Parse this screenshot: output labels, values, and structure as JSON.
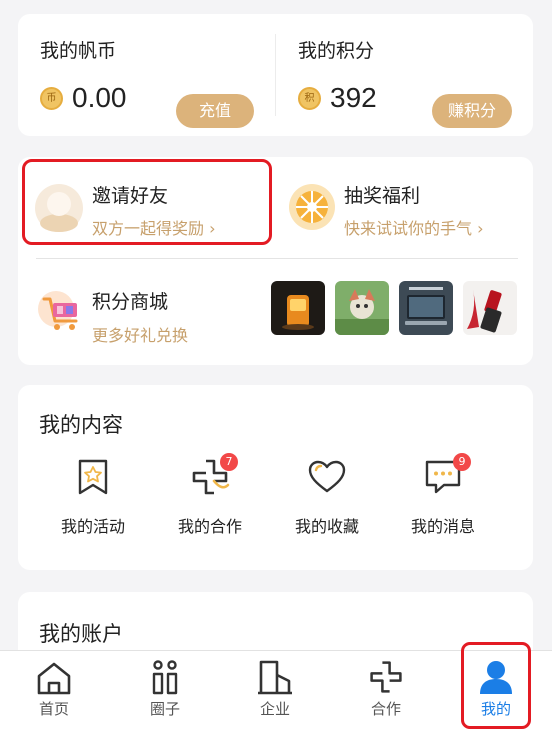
{
  "wallet": {
    "coins": {
      "title": "我的帆币",
      "coin_glyph": "币",
      "value": "0.00",
      "button": "充值"
    },
    "points": {
      "title": "我的积分",
      "coin_glyph": "积",
      "value": "392",
      "button": "赚积分"
    }
  },
  "activities": {
    "invite": {
      "title": "邀请好友",
      "subtitle": "双方一起得奖励 ›"
    },
    "lottery": {
      "title": "抽奖福利",
      "subtitle": "快来试试你的手气 ›"
    },
    "mall": {
      "title": "积分商城",
      "subtitle": "更多好礼兑换"
    }
  },
  "my_content": {
    "title": "我的内容",
    "items": [
      {
        "label": "我的活动",
        "icon": "bookmark-star-icon",
        "badge": ""
      },
      {
        "label": "我的合作",
        "icon": "cooperation-icon",
        "badge": "7"
      },
      {
        "label": "我的收藏",
        "icon": "heart-icon",
        "badge": ""
      },
      {
        "label": "我的消息",
        "icon": "message-icon",
        "badge": "9"
      }
    ]
  },
  "account": {
    "title": "我的账户"
  },
  "tabbar": {
    "items": [
      {
        "label": "首页",
        "icon": "home-icon"
      },
      {
        "label": "圈子",
        "icon": "circle-icon"
      },
      {
        "label": "企业",
        "icon": "enterprise-icon"
      },
      {
        "label": "合作",
        "icon": "cooperation-icon"
      },
      {
        "label": "我的",
        "icon": "user-icon"
      }
    ],
    "active_index": 4
  },
  "colors": {
    "accent_gold": "#dcb37b",
    "subtitle_gold": "#c7a06c",
    "highlight_red": "#e31b23",
    "active_blue": "#1b7ee6",
    "badge_red": "#f24848"
  }
}
